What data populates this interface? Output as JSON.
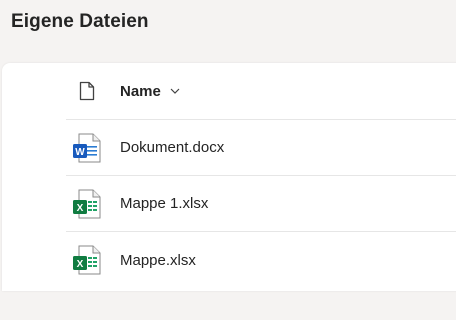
{
  "page": {
    "title": "Eigene Dateien"
  },
  "table": {
    "header": {
      "name_label": "Name",
      "type_icon": "document-icon",
      "sort_icon": "chevron-down-icon"
    },
    "rows": [
      {
        "name": "Dokument.docx",
        "icon": "word-icon",
        "color": "#185abd"
      },
      {
        "name": "Mappe 1.xlsx",
        "icon": "excel-icon",
        "color": "#107c41"
      },
      {
        "name": "Mappe.xlsx",
        "icon": "excel-icon",
        "color": "#107c41"
      }
    ]
  }
}
